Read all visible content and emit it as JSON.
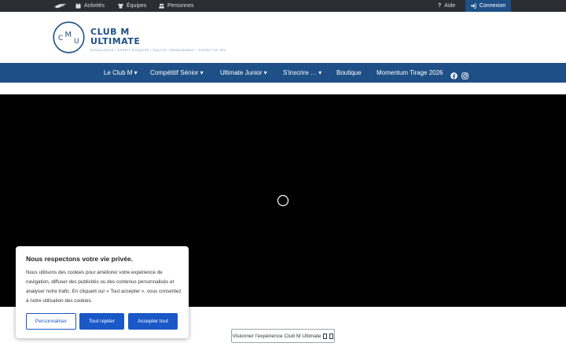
{
  "topbar": {
    "logo_icon": "tiny-flying-disc-logo-icon",
    "activities": "Activités",
    "activities_icon": "calendar-icon",
    "teams": "Équipes",
    "teams_icon": "jersey-icon",
    "people": "Personnes",
    "people_icon": "people-icon",
    "help": "Aide",
    "help_icon": "question-icon",
    "login": "Connexion",
    "login_icon": "sign-in-icon",
    "colors": {
      "bar": "#2b2d33",
      "login_bg": "#1e4f86"
    }
  },
  "brand": {
    "logo_letters": [
      "C",
      "M",
      "U"
    ],
    "name_line1": "CLUB M",
    "name_line2": "ULTIMATE",
    "tagline": "EXCELLENCE • ESPRIT D'ÉQUIPE • ÉQUITÉ • ENGAGEMENT • ESPRIT DE JEU",
    "color": "#1e4f86"
  },
  "nav": {
    "items": [
      {
        "label": "Le Club M ▾"
      },
      {
        "label": "Compétitif Sénior ▾"
      },
      {
        "label": "Ultimate Junior ▾"
      },
      {
        "label": "S'inscrire … ▾"
      },
      {
        "label": "Boutique"
      },
      {
        "label": "Momentum Tirage 2026"
      }
    ],
    "social": [
      "facebook-icon",
      "instagram-icon"
    ],
    "color": "#1e4f86"
  },
  "video": {
    "state_icon": "loading-spinner-icon",
    "background": "#000000"
  },
  "cookie": {
    "title": "Nous respectons votre vie privée.",
    "body": "Nous utilisons des cookies pour améliorer votre expérience de navigation, diffuser des publicités ou des contenus personnalisés et analyser notre trafic. En cliquant sur « Tout accepter », vous consentez à notre utilisation des cookies.",
    "customize": "Personnaliser",
    "reject": "Tout rejeter",
    "accept": "Accepter tout",
    "accent": "#1b58c7"
  },
  "experience_button": {
    "label": "Visionner l'expérience Club M Ultimate"
  }
}
